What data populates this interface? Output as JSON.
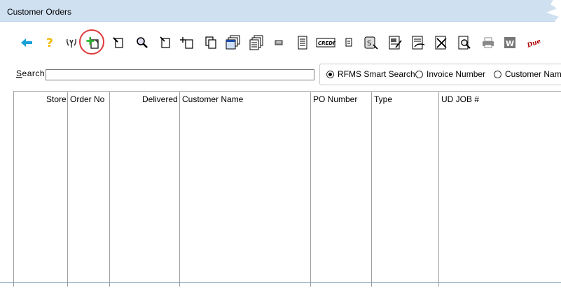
{
  "window": {
    "title": "Customer Orders"
  },
  "toolbar": {
    "buttons": [
      {
        "icon": "back-arrow-icon"
      },
      {
        "icon": "help-icon"
      },
      {
        "icon": "connection-icon"
      },
      {
        "icon": "new-order-icon"
      },
      {
        "icon": "edit-document-icon"
      },
      {
        "icon": "find-icon"
      },
      {
        "icon": "document-icon"
      },
      {
        "icon": "add-document-icon"
      },
      {
        "icon": "copy-icon"
      },
      {
        "icon": "stacked-windows-icon"
      },
      {
        "icon": "stacked-documents-icon"
      },
      {
        "icon": "small-chip-icon"
      },
      {
        "icon": "invoice-icon"
      },
      {
        "icon": "credit-card-icon"
      },
      {
        "icon": "small-page-icon"
      },
      {
        "icon": "s-document-icon"
      },
      {
        "icon": "edit-form-icon"
      },
      {
        "icon": "sign-document-icon"
      },
      {
        "icon": "tools-document-icon"
      },
      {
        "icon": "search-document-icon"
      },
      {
        "icon": "print-icon"
      },
      {
        "icon": "word-icon"
      },
      {
        "icon": "due-icon"
      }
    ],
    "credit_label": "CREDIT",
    "word_label": "W",
    "due_label": "Due"
  },
  "search": {
    "label": "Search",
    "label_underlined": "S",
    "label_rest": "earch",
    "value": "",
    "options": [
      {
        "label": "RFMS Smart Search",
        "selected": true
      },
      {
        "label": "Invoice Number",
        "selected": false
      },
      {
        "label": "Customer Name",
        "selected": false
      }
    ]
  },
  "table": {
    "columns": [
      "Store",
      "Order No",
      "Delivered",
      "Customer Name",
      "PO Number",
      "Type",
      "UD JOB #"
    ],
    "rows": []
  },
  "colors": {
    "titlebar": "#cfe0f1",
    "highlight": "#e0393c",
    "accent_blue": "#1aa0d8"
  }
}
